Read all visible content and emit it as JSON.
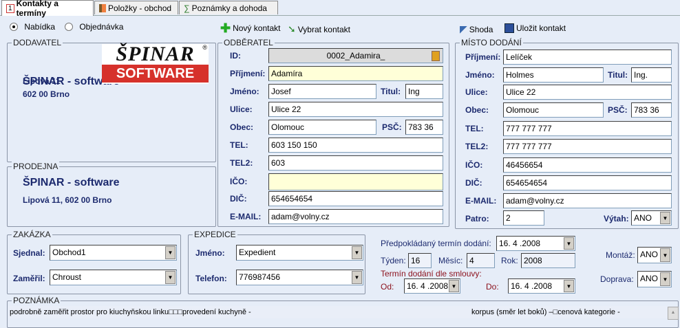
{
  "tabs": [
    {
      "label": "Kontakty a termíny",
      "icon": "number-1-icon"
    },
    {
      "label": "Položky - obchod",
      "icon": "door-icon"
    },
    {
      "label": "Poznámky a dohoda",
      "icon": "sigma-icon"
    }
  ],
  "radio": {
    "offer": "Nabídka",
    "order": "Objednávka",
    "selected": "Nabídka"
  },
  "toolbar": {
    "new": "Nový kontakt",
    "select": "Vybrat kontakt",
    "match": "Shoda",
    "save": "Uložit kontakt"
  },
  "supplier": {
    "title": "DODAVATEL",
    "name": "ŠPINAR - software",
    "street": "Lipová 11",
    "city": "602 00 Brno",
    "logo_top": "ŠPINAR",
    "logo_bottom": "SOFTWARE",
    "logo_reg": "®"
  },
  "shop": {
    "title": "PRODEJNA",
    "name": "ŠPINAR - software",
    "address": "Lipová 11, 602 00 Brno"
  },
  "customer": {
    "title": "ODBĚRATEL",
    "labels": {
      "id": "ID:",
      "surname": "Příjmení:",
      "name": "Jméno:",
      "title": "Titul:",
      "street": "Ulice:",
      "city": "Obec:",
      "zip": "PSČ:",
      "tel": "TEL:",
      "tel2": "TEL2:",
      "ico": "IČO:",
      "dic": "DIČ:",
      "email": "E-MAIL:"
    },
    "values": {
      "id": "0002_Adamira_",
      "surname": "Adamíra",
      "name": "Josef",
      "title": "Ing",
      "street": "Ulice 22",
      "city": "Olomouc",
      "zip": "783 36",
      "tel": "603 150 150",
      "tel2": "603",
      "ico": "",
      "dic": "654654654",
      "email": "adam@volny.cz"
    }
  },
  "delivery": {
    "title": "MÍSTO DODÁNÍ",
    "labels": {
      "surname": "Příjmení:",
      "name": "Jméno:",
      "title": "Titul:",
      "street": "Ulice:",
      "city": "Obec:",
      "zip": "PSČ:",
      "tel": "TEL:",
      "tel2": "TEL2:",
      "ico": "IČO:",
      "dic": "DIČ:",
      "email": "E-MAIL:",
      "floor": "Patro:",
      "lift": "Výtah:"
    },
    "values": {
      "surname": "Lelíček",
      "name": "Holmes",
      "title": "Ing.",
      "street": "Ulice 22",
      "city": "Olomouc",
      "zip": "783 36",
      "tel": "777 777 777",
      "tel2": "777 777 777",
      "ico": "46456654",
      "dic": "654654654",
      "email": "adam@volny.cz",
      "floor": "2",
      "lift": "ANO"
    }
  },
  "order": {
    "title": "ZAKÁZKA",
    "agreed_label": "Sjednal:",
    "agreed": "Obchod1",
    "measured_label": "Zaměřil:",
    "measured": "Chroust"
  },
  "shipping": {
    "title": "EXPEDICE",
    "name_label": "Jméno:",
    "name": "Expedient",
    "phone_label": "Telefon:",
    "phone": "776987456"
  },
  "terms": {
    "expected_label": "Předpokládaný termín dodání:",
    "expected": "16. 4 .2008",
    "week_label": "Týden:",
    "week": "16",
    "month_label": "Měsíc:",
    "month": "4",
    "year_label": "Rok:",
    "year": "2008",
    "contract_label": "Termín dodání dle smlouvy:",
    "from_label": "Od:",
    "from": "16. 4 .2008",
    "to_label": "Do:",
    "to": "16. 4 .2008",
    "assembly_label": "Montáž:",
    "assembly": "ANO",
    "transport_label": "Doprava:",
    "transport": "ANO"
  },
  "note": {
    "title": "POZNÁMKA",
    "text1": "podrobně zaměřit prostor pro kiuchyňskou linku□□□provedení kuchyně -",
    "text2": "korpus (směr let boků) –□cenová kategorie -"
  }
}
